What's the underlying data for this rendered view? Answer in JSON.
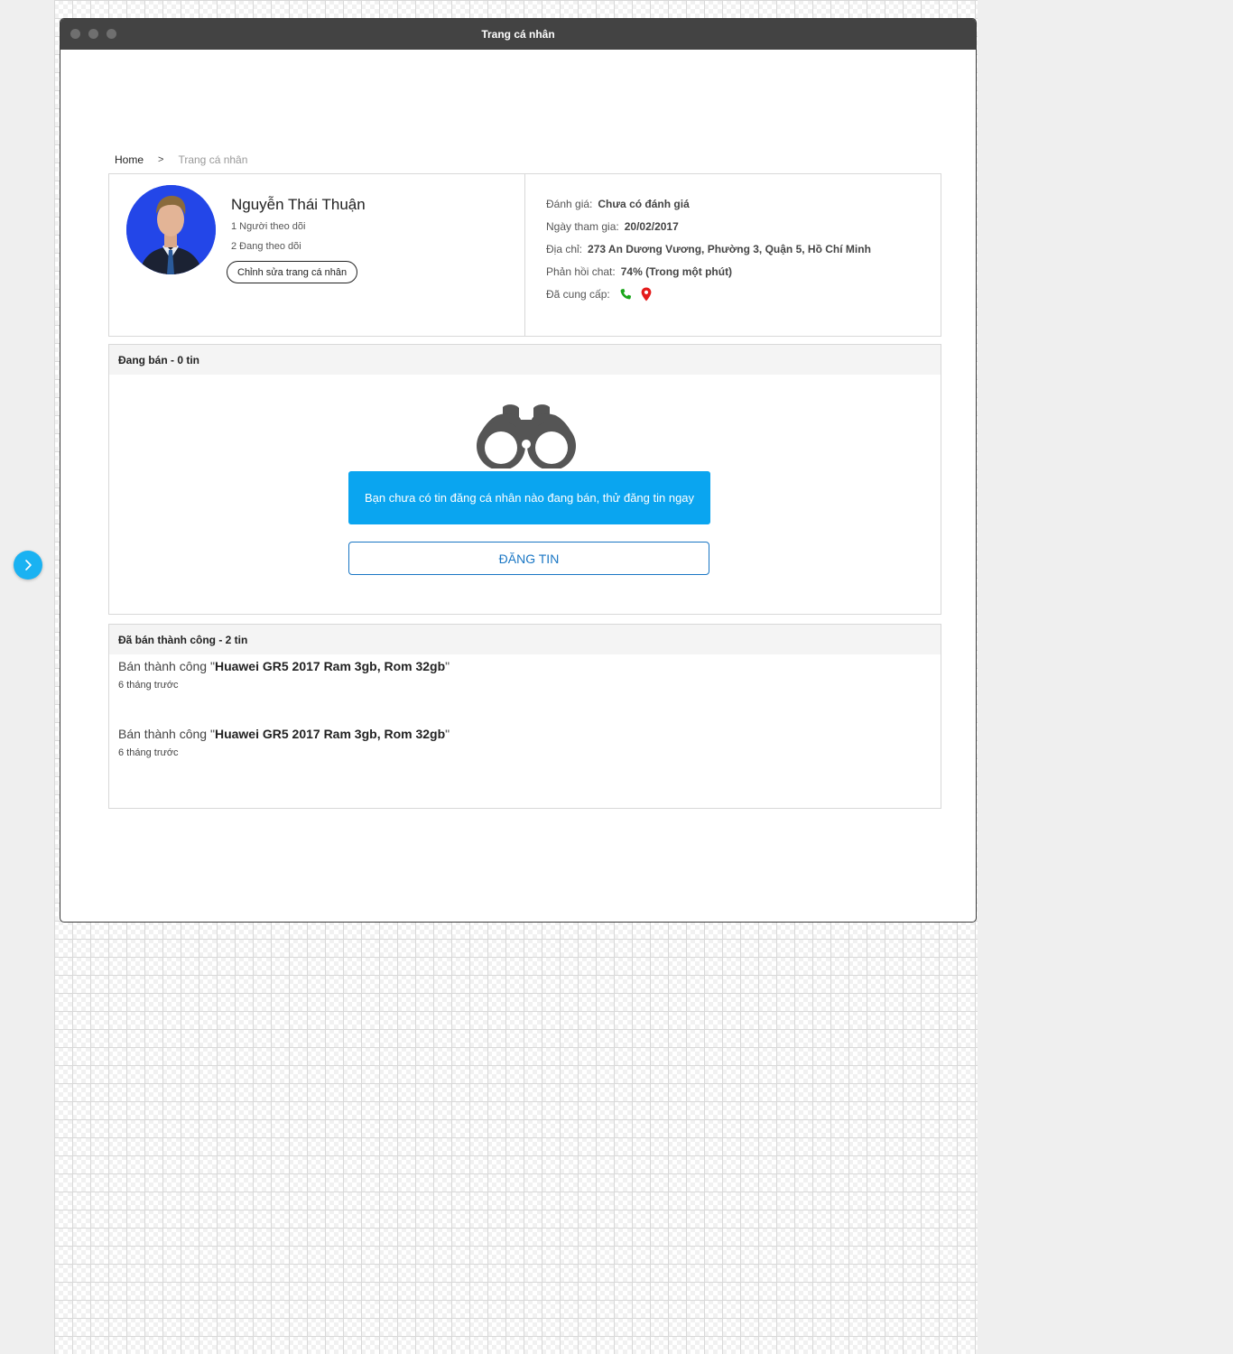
{
  "window": {
    "title": "Trang cá nhân"
  },
  "breadcrumb": {
    "home": "Home",
    "separator": ">",
    "current": "Trang cá nhân"
  },
  "profile": {
    "name": "Nguyễn Thái Thuận",
    "followers": "1 Người theo dõi",
    "following": "2 Đang theo dõi",
    "edit_button": "Chỉnh sửa trang cá nhân",
    "info": {
      "rating_label": "Đánh giá:",
      "rating_value": "Chưa có đánh giá",
      "joined_label": "Ngày tham gia:",
      "joined_value": "20/02/2017",
      "address_label": "Địa chỉ:",
      "address_value": "273 An Dương Vương, Phường 3, Quận 5, Hồ Chí Minh",
      "response_label": "Phản hồi chat:",
      "response_value": "74% (Trong một phút)",
      "provided_label": "Đã cung cấp:",
      "provided_icons": [
        "phone-icon",
        "location-pin-icon"
      ]
    }
  },
  "selling": {
    "header": "Đang bán - 0 tin",
    "empty_message": "Bạn chưa có tin đăng cá nhân nào đang bán, thử đăng tin ngay",
    "post_button": "ĐĂNG TIN"
  },
  "sold": {
    "header": "Đã bán thành công - 2 tin",
    "items": [
      {
        "prefix": "Bán thành công \"",
        "product": "Huawei GR5 2017 Ram 3gb, Rom 32gb",
        "suffix": "\"",
        "time": "6 tháng trước"
      },
      {
        "prefix": "Bán thành công \"",
        "product": "Huawei GR5 2017 Ram 3gb, Rom 32gb",
        "suffix": "\"",
        "time": "6 tháng trước"
      }
    ]
  },
  "colors": {
    "accent": "#0aa5f0",
    "button_border": "#1976c4",
    "phone_icon": "#1aa61a",
    "pin_icon": "#e41b1b",
    "titlebar": "#434343"
  }
}
